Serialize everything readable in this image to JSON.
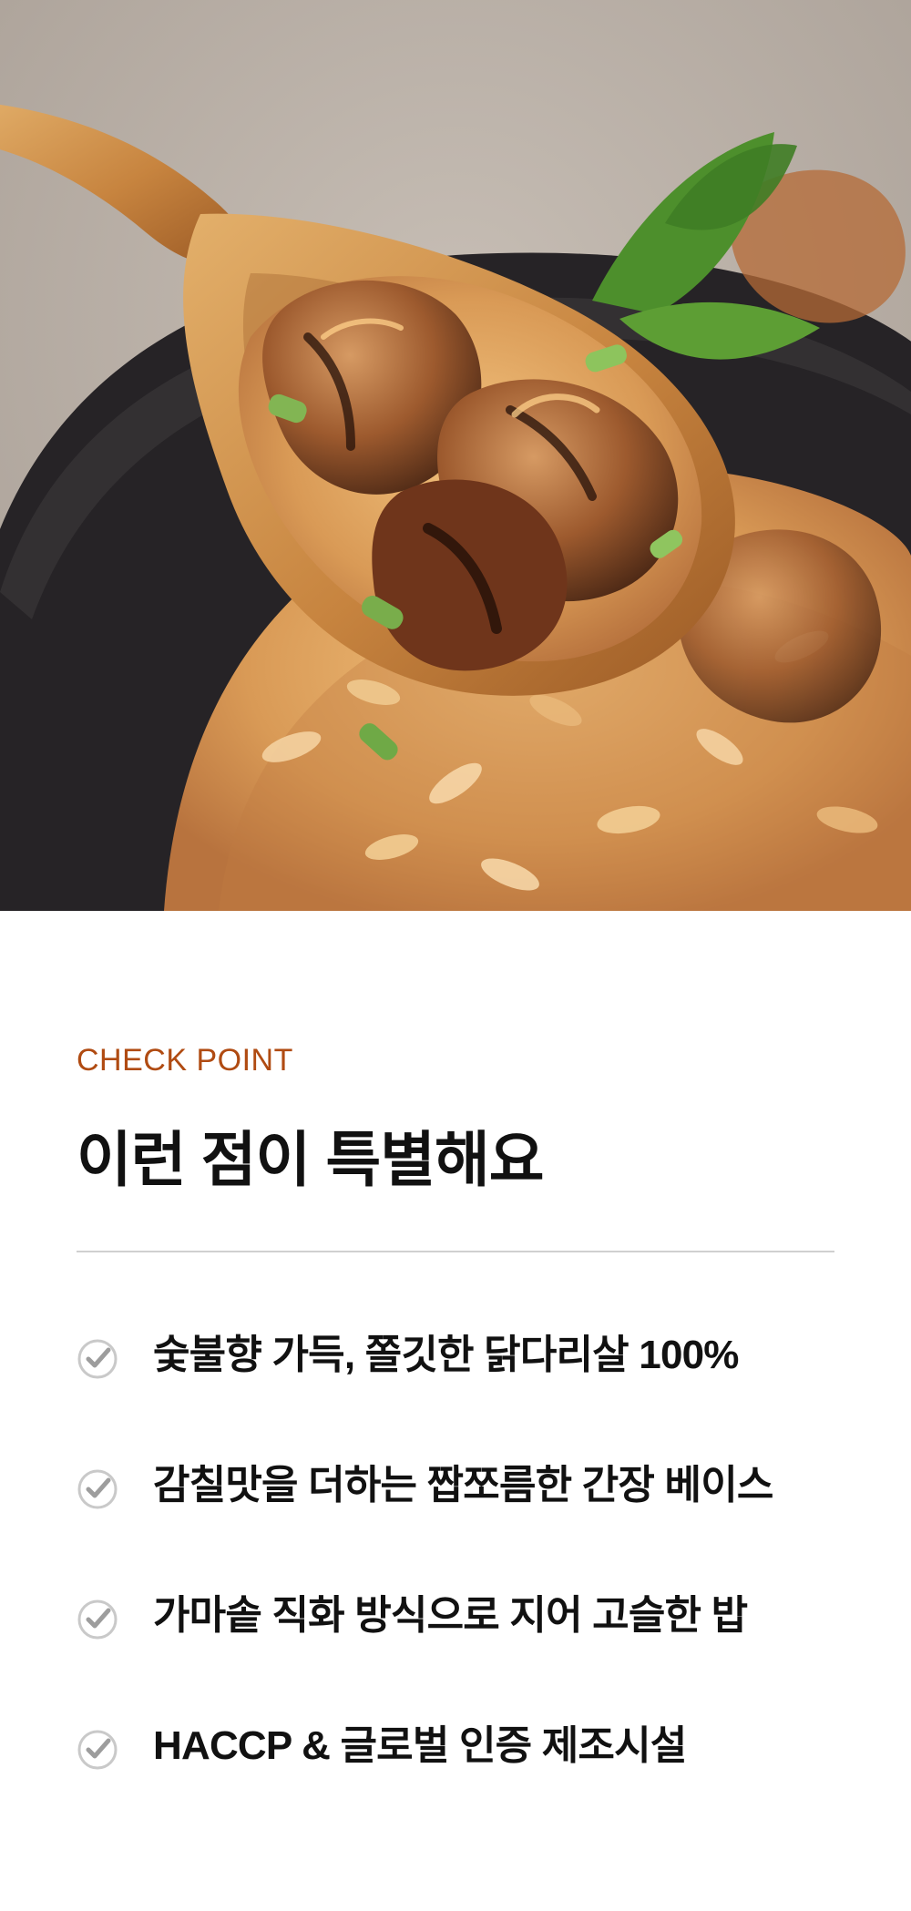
{
  "hero": {
    "image_description": "Close-up food photo: wooden spoon lifting grilled chicken and fried rice from a dark bowl",
    "colors": {
      "background": "#b9b0a7",
      "bowl": "#252326",
      "spoon": "#c88a45",
      "rice": "#d8a45f",
      "chicken": "#9a5a2d",
      "herb": "#4d8f2c"
    }
  },
  "section": {
    "eyebrow": "CHECK POINT",
    "title": "이런 점이 특별해요",
    "features": [
      {
        "icon": "check-icon",
        "text": "숯불향 가득, 쫄깃한 닭다리살 100%"
      },
      {
        "icon": "check-icon",
        "text": "감칠맛을 더하는 짭쪼름한 간장 베이스"
      },
      {
        "icon": "check-icon",
        "text": "가마솥 직화 방식으로 지어 고슬한 밥"
      },
      {
        "icon": "check-icon",
        "text": "HACCP & 글로벌 인증 제조시설"
      }
    ],
    "colors": {
      "accent": "#b04b12",
      "text": "#111111",
      "divider": "#d0d0d0",
      "check": "#c9c9c9"
    }
  }
}
